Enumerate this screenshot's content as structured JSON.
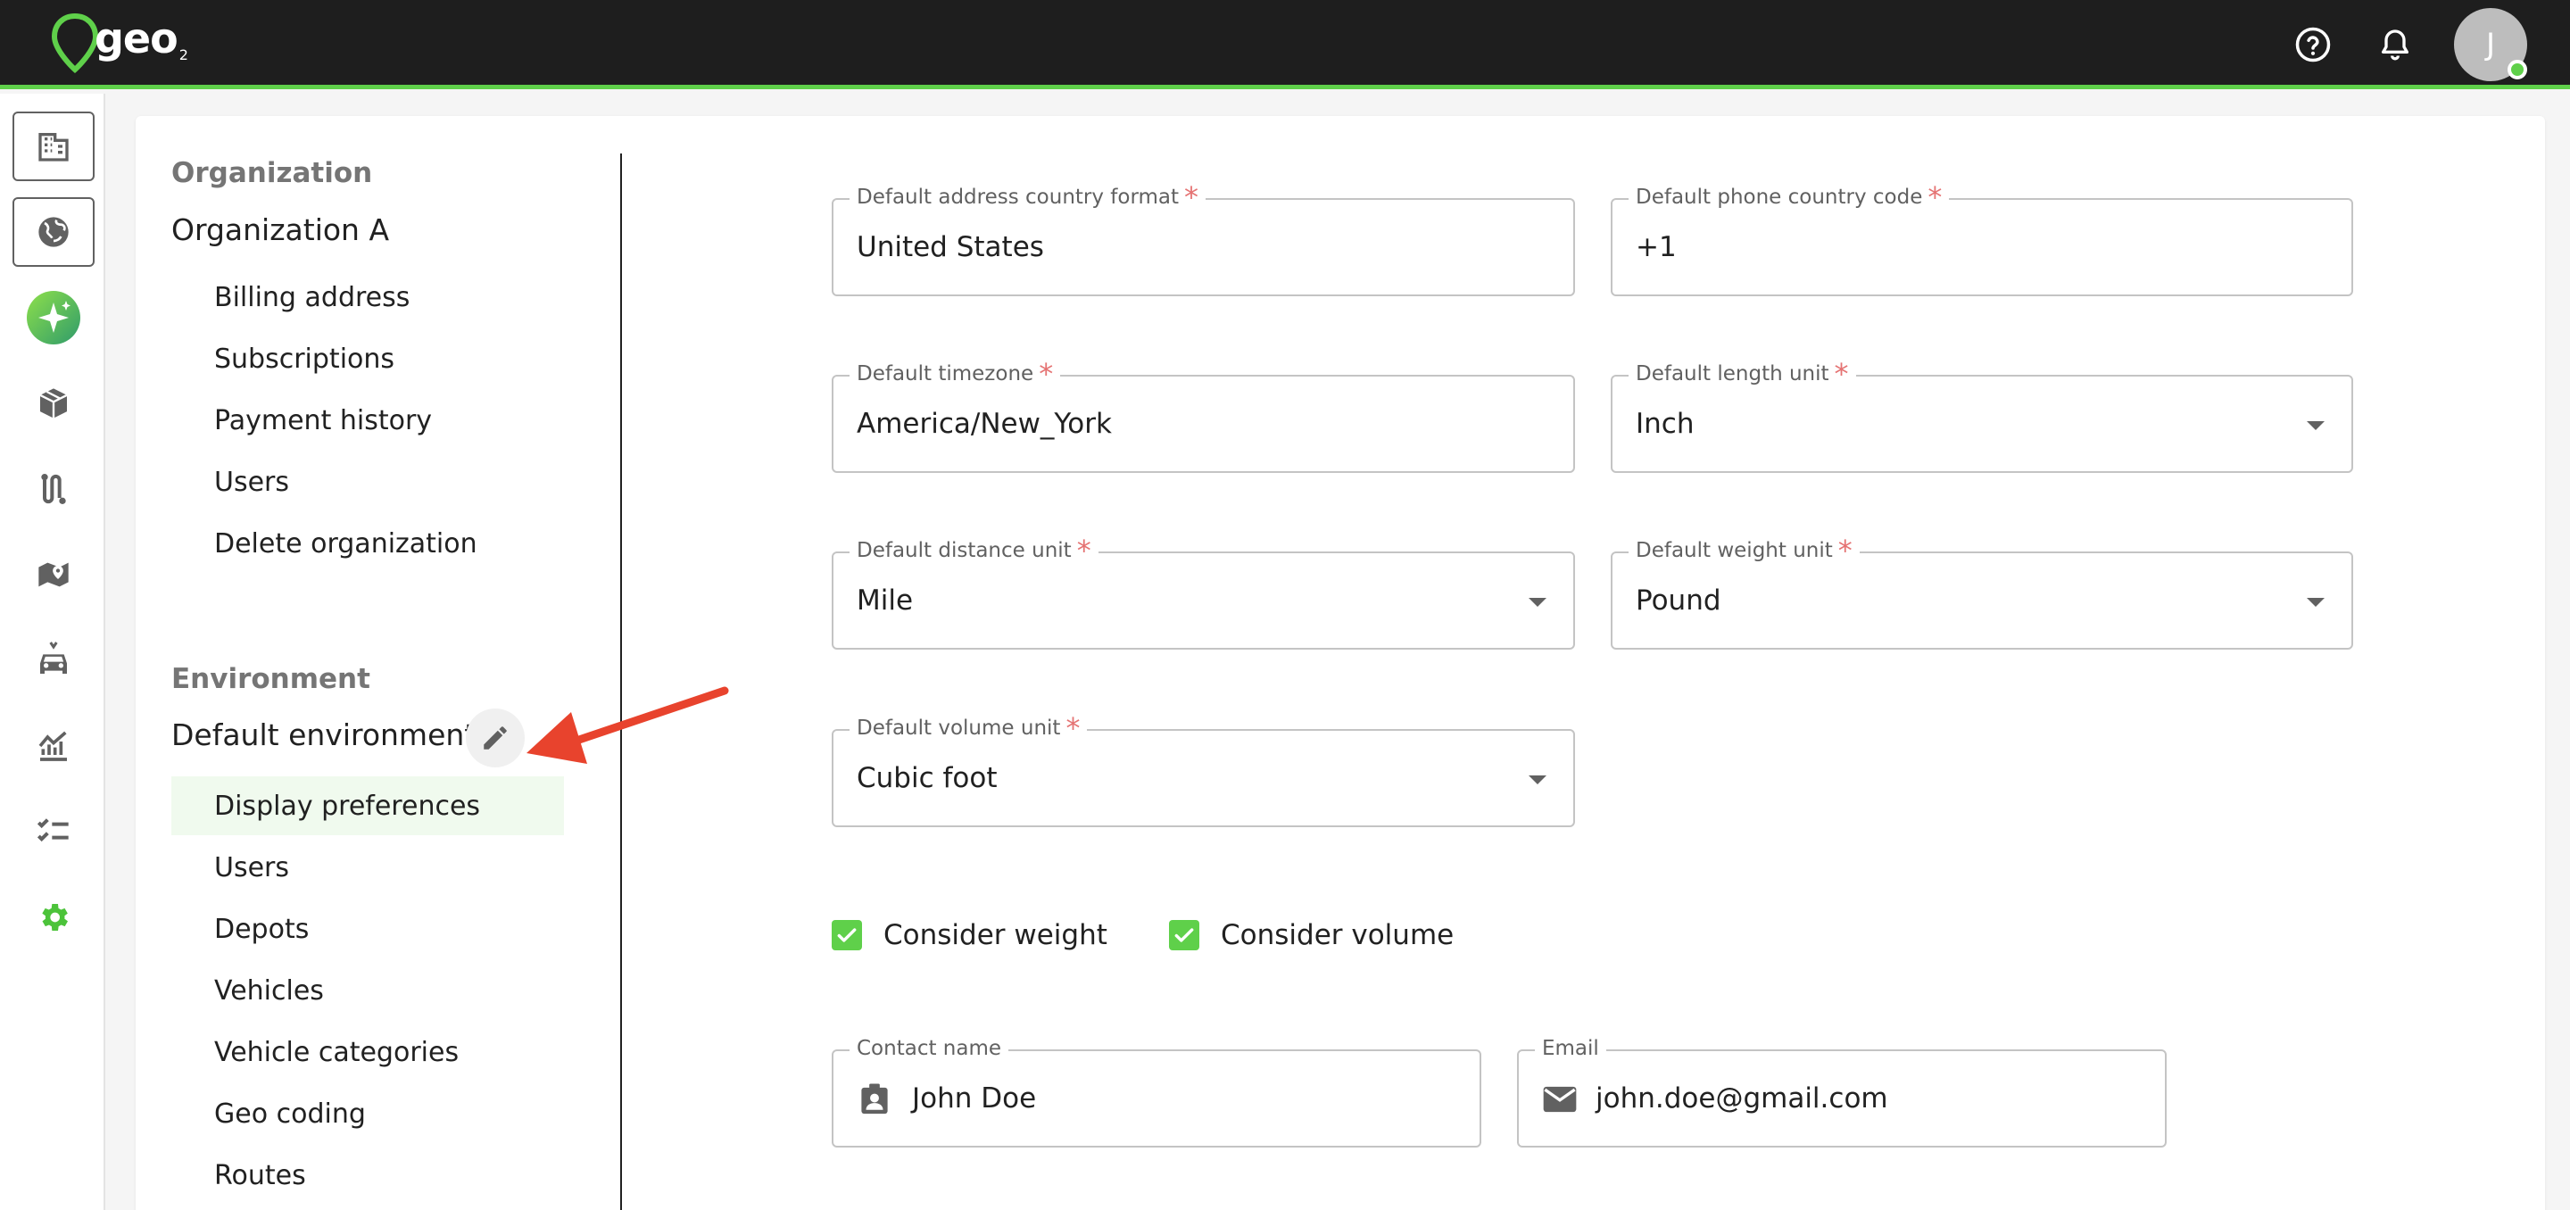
{
  "brand": {
    "logo_text": "geo",
    "logo_sub": "2",
    "accent": "#5fd04a",
    "topbar_bg": "#1e1e1e"
  },
  "topbar": {
    "help_icon": "help-circle-icon",
    "notifications_icon": "bell-icon",
    "avatar_initial": "J"
  },
  "rail": {
    "items": [
      {
        "icon": "building-icon"
      },
      {
        "icon": "globe-icon"
      },
      {
        "icon": "sparkle-icon"
      },
      {
        "icon": "package-icon"
      },
      {
        "icon": "route-icon"
      },
      {
        "icon": "map-pin-icon"
      },
      {
        "icon": "vehicle-icon"
      },
      {
        "icon": "analytics-icon"
      },
      {
        "icon": "checklist-icon"
      },
      {
        "icon": "gear-icon"
      }
    ]
  },
  "nav": {
    "organization_heading": "Organization",
    "organization_name": "Organization A",
    "organization_items": [
      "Billing address",
      "Subscriptions",
      "Payment history",
      "Users",
      "Delete organization"
    ],
    "environment_heading": "Environment",
    "environment_name": "Default environment",
    "environment_items": [
      "Display preferences",
      "Users",
      "Depots",
      "Vehicles",
      "Vehicle categories",
      "Geo coding",
      "Routes"
    ],
    "selected_item": "Display preferences"
  },
  "form": {
    "address_format": {
      "label": "Default address country format",
      "value": "United States",
      "required": "*"
    },
    "phone_code": {
      "label": "Default phone country code",
      "value": "+1",
      "required": "*"
    },
    "timezone": {
      "label": "Default timezone",
      "value": "America/New_York",
      "required": "*"
    },
    "length_unit": {
      "label": "Default length unit",
      "value": "Inch",
      "required": "*"
    },
    "distance_unit": {
      "label": "Default distance unit",
      "value": "Mile",
      "required": "*"
    },
    "weight_unit": {
      "label": "Default weight unit",
      "value": "Pound",
      "required": "*"
    },
    "volume_unit": {
      "label": "Default volume unit",
      "value": "Cubic foot",
      "required": "*"
    },
    "consider_weight": {
      "label": "Consider weight",
      "checked": true
    },
    "consider_volume": {
      "label": "Consider volume",
      "checked": true
    },
    "contact_name": {
      "label": "Contact name",
      "value": "John Doe"
    },
    "email": {
      "label": "Email",
      "value": "john.doe@gmail.com"
    }
  },
  "annotation": {
    "color": "#e8432d"
  }
}
